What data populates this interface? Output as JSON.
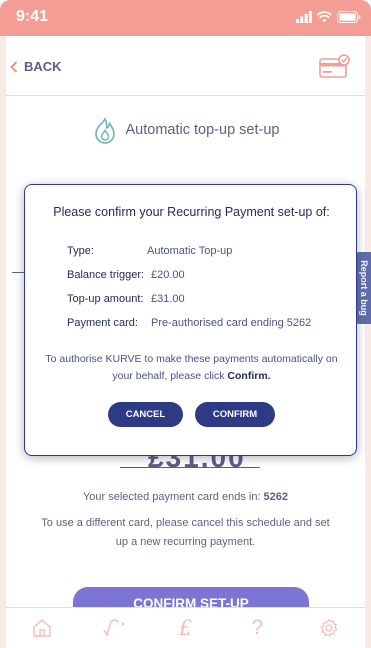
{
  "status_bar": {
    "time": "9:41"
  },
  "header": {
    "back_label": "BACK"
  },
  "page": {
    "title": "Automatic top-up set-up",
    "amount_partial": "£31.00",
    "card_ends_text": "Your selected payment card ends in: ",
    "card_ends_number": "5262",
    "different_card_text": "To use a different card, please cancel this schedule and set up a new recurring payment.",
    "confirm_setup_label": "CONFIRM SET-UP"
  },
  "report_bug_label": "Report a bug",
  "modal": {
    "title": "Please confirm your Recurring Payment set-up of:",
    "rows": [
      {
        "label": "Type:",
        "value": "Automatic Top-up"
      },
      {
        "label": "Balance trigger:",
        "value": "£20.00"
      },
      {
        "label": "Top-up amount:",
        "value": "£31.00"
      },
      {
        "label": "Payment card:",
        "value": "Pre-authorised card ending 5262"
      }
    ],
    "auth_text": "To authorise KURVE to make these payments automatically on your behalf, please click ",
    "auth_emphasis": "Confirm.",
    "cancel_label": "CANCEL",
    "confirm_label": "CONFIRM"
  },
  "tabbar": {
    "icons": [
      "home-icon",
      "usage-graph-icon",
      "pound-icon",
      "help-icon",
      "settings-icon"
    ]
  },
  "colors": {
    "status_bar": "#f07d72",
    "navy": "#262a5c",
    "modal_button": "#2d3b86",
    "primary_button": "#5147c4",
    "tab_icons": "#f5a79c"
  }
}
